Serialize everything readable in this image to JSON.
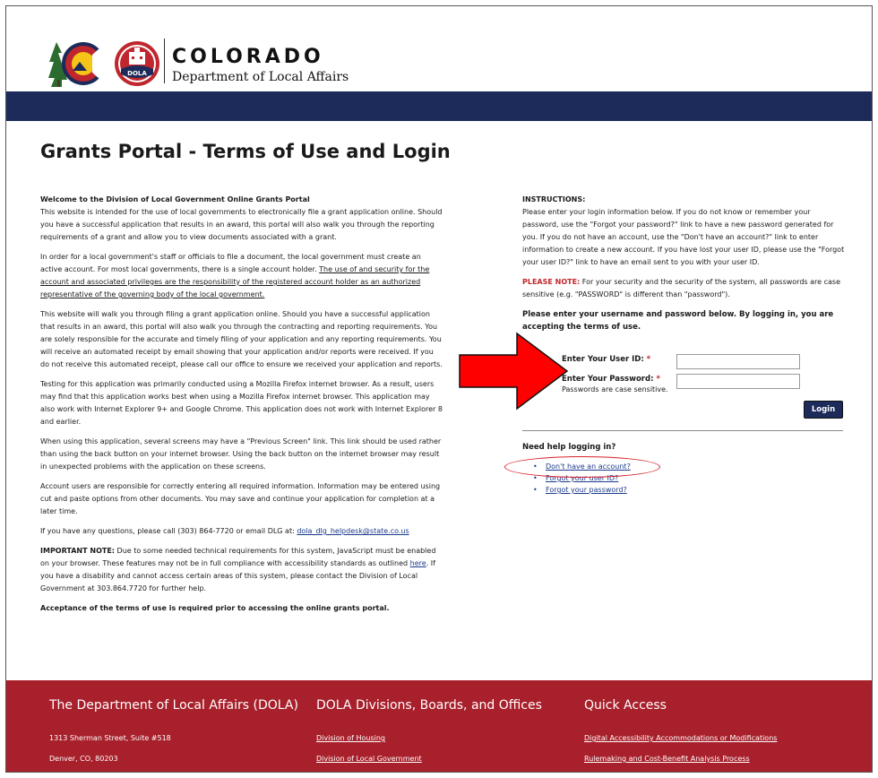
{
  "header": {
    "brand_title": "COLORADO",
    "brand_subtitle": "Department of Local Affairs",
    "logo_badge": "DOLA",
    "colors": {
      "nav_bar": "#1c2b5a",
      "footer": "#a8202b",
      "accent_red": "#c0262d",
      "link": "#1a3a8a"
    }
  },
  "page_title": "Grants Portal - Terms of Use and Login",
  "intro": {
    "welcome_heading": "Welcome to the Division of Local Government Online Grants Portal",
    "welcome_text": "This website is intended for the use of local governments to electronically file a grant application online. Should you have a successful application that results in an award, this portal will also walk you through the reporting requirements of a grant and allow you to view documents associated with a grant.",
    "account_text": "In order for a local government's staff or officials to file a document, the local government must create an active account. For most local governments, there is a single account holder.",
    "account_underline": "The use of and security for the account and associated privileges are the responsibility of the registered account holder as an authorized representative of the governing body of the local government.",
    "walkthrough_text": "This website will walk you through filing a grant application online. Should you have a successful application that results in an award, this portal will also walk you through the contracting and reporting requirements. You are solely responsible for the accurate and timely filing of your application and any reporting requirements. You will receive an automated receipt by email showing that your application and/or reports were received. If you do not receive this automated receipt, please call our office to ensure we received your application and reports.",
    "browser_text": "Testing for this application was primarily conducted using a Mozilla Firefox internet browser. As a result, users may find that this application works best when using a Mozilla Firefox internet browser. This application may also work with Internet Explorer 9+ and Google Chrome. This application does not work with Internet Explorer 8 and earlier.",
    "previous_screen_text": "When using this application, several screens may have a \"Previous Screen\" link. This link should be used rather than using the back button on your internet browser. Using the back button on the internet browser may result in unexpected problems with the application on these screens.",
    "users_text": "Account users are responsible for correctly entering all required information. Information may be entered using cut and paste options from other documents. You may save and continue your application for completion at a later time.",
    "questions_text": "If you have any questions, please call (303) 864-7720 or email DLG at:",
    "questions_email": "dola_dlg_helpdesk@state.co.us",
    "important_label": "IMPORTANT NOTE:",
    "important_text_1": "Due to some needed technical requirements for this system, JavaScript must be enabled on your browser. These features may not be in full compliance with accessibility standards as outlined",
    "important_link": "here",
    "important_text_2": ". If you have a disability and cannot access certain areas of this system, please contact the Division of Local Government at 303.864.7720 for further help.",
    "acceptance_text": "Acceptance of the terms of use is required prior to accessing the online grants portal."
  },
  "instructions": {
    "heading": "INSTRUCTIONS:",
    "text": "Please enter your login information below. If you do not know or remember your password, use the \"Forgot your password?\" link to have a new password generated for you. If you do not have an account, use the \"Don't have an account?\" link to enter information to create a new account. If you have lost your user ID, please use the \"Forgot your user ID?\" link to have an email sent to you with your user ID.",
    "note_label": "PLEASE NOTE:",
    "note_text": "For your security and the security of the system, all passwords are case sensitive (e.g. \"PASSWORD\" is different than \"password\").",
    "accept_text": "Please enter your username and password below. By logging in, you are accepting the terms of use."
  },
  "login": {
    "user_id_label": "Enter Your User ID:",
    "user_id_value": "",
    "password_label": "Enter Your Password:",
    "password_value": "",
    "password_hint": "Passwords are case sensitive.",
    "required_marker": "*",
    "login_button": "Login"
  },
  "help": {
    "heading": "Need help logging in?",
    "links": [
      "Don't have an account?",
      "Forgot your user ID?",
      "Forgot your password?"
    ]
  },
  "footer": {
    "col1_heading": "The Department of Local Affairs (DOLA)",
    "col1_line1": "1313 Sherman Street, Suite #518",
    "col1_line2": "Denver, CO, 80203",
    "col2_heading": "DOLA Divisions, Boards, and Offices",
    "col2_links": [
      "Division of Housing",
      "Division of Local Government"
    ],
    "col3_heading": "Quick Access",
    "col3_links": [
      "Digital Accessibility Accommodations or Modifications",
      "Rulemaking and Cost-Benefit Analysis Process"
    ]
  }
}
